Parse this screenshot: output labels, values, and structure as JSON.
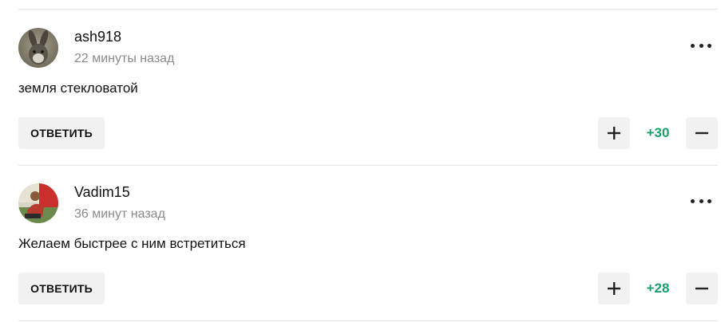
{
  "comments": [
    {
      "username": "ash918",
      "time": "22 минуты назад",
      "text": "земля стекловатой",
      "reply_label": "ОТВЕТИТЬ",
      "score": "+30",
      "avatar_icon": "hare-avatar-icon",
      "score_color": "#1aa16a"
    },
    {
      "username": "Vadim15",
      "time": "36 минут назад",
      "text": "Желаем быстрее с ним встретиться",
      "reply_label": "ОТВЕТИТЬ",
      "score": "+28",
      "avatar_icon": "photo-avatar-icon",
      "score_color": "#1aa16a"
    }
  ]
}
